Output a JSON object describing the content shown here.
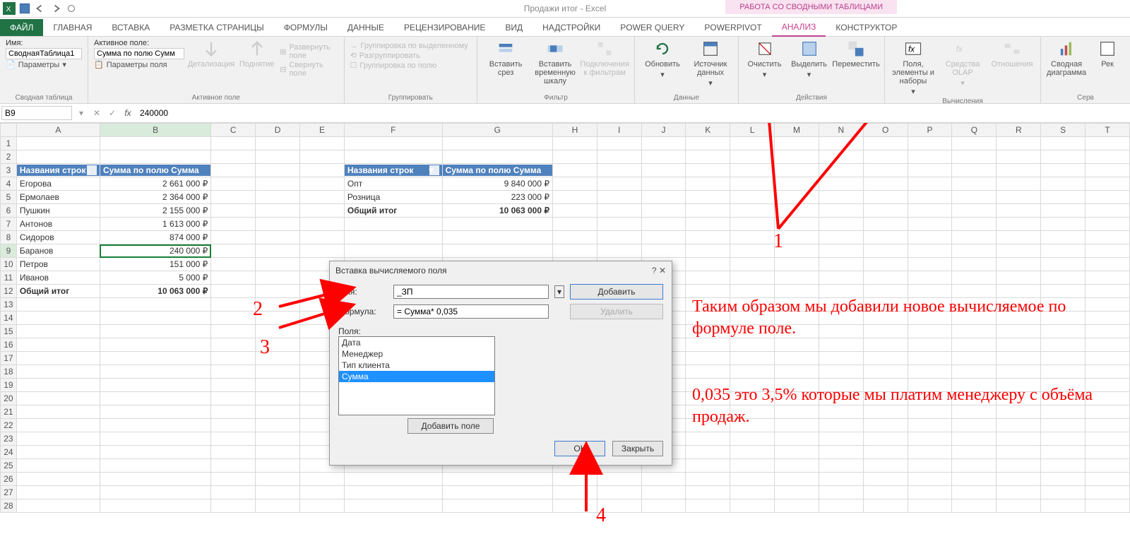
{
  "app_title": "Продажи итог - Excel",
  "contextual_tab": "РАБОТА СО СВОДНЫМИ ТАБЛИЦАМИ",
  "tabs": [
    "ФАЙЛ",
    "ГЛАВНАЯ",
    "ВСТАВКА",
    "РАЗМЕТКА СТРАНИЦЫ",
    "ФОРМУЛЫ",
    "ДАННЫЕ",
    "РЕЦЕНЗИРОВАНИЕ",
    "ВИД",
    "НАДСТРОЙКИ",
    "POWER QUERY",
    "POWERPIVOT",
    "АНАЛИЗ",
    "КОНСТРУКТОР"
  ],
  "ribbon": {
    "g1": {
      "label": "Сводная таблица",
      "name_lbl": "Имя:",
      "name_val": "СводнаяТаблица1",
      "params": "Параметры"
    },
    "g2": {
      "label": "Активное поле",
      "af_lbl": "Активное поле:",
      "af_val": "Сумма по полю Сумм",
      "fs": "Параметры поля",
      "drill_down": "Детализация",
      "drill_up": "Поднятие",
      "expand": "Развернуть поле",
      "collapse": "Свернуть поле"
    },
    "g3": {
      "label": "Группировать",
      "i1": "Группировка по выделенному",
      "i2": "Разгруппировать",
      "i3": "Группировка по полю"
    },
    "g4": {
      "label": "Фильтр",
      "slicer": "Вставить срез",
      "timeline": "Вставить временную шкалу",
      "conn": "Подключения к фильтрам"
    },
    "g5": {
      "label": "Данные",
      "refresh": "Обновить",
      "source": "Источник данных"
    },
    "g6": {
      "label": "Действия",
      "clear": "Очистить",
      "select": "Выделить",
      "move": "Переместить"
    },
    "g7": {
      "label": "Вычисления",
      "fields": "Поля, элементы и наборы",
      "olap": "Средства OLAP",
      "rel": "Отношения"
    },
    "g8": {
      "label": "Серв",
      "chart": "Сводная диаграмма",
      "rec": "Рек"
    }
  },
  "namebox": "B9",
  "formula_value": "240000",
  "columns": [
    "A",
    "B",
    "C",
    "D",
    "E",
    "F",
    "G",
    "H",
    "I",
    "J",
    "K",
    "L",
    "M",
    "N",
    "O",
    "P",
    "Q",
    "R",
    "S",
    "T"
  ],
  "pt1": {
    "h1": "Названия строк",
    "h2": "Сумма по полю Сумма",
    "rows": [
      [
        "Егорова",
        "2 661 000 ₽"
      ],
      [
        "Ермолаев",
        "2 364 000 ₽"
      ],
      [
        "Пушкин",
        "2 155 000 ₽"
      ],
      [
        "Антонов",
        "1 613 000 ₽"
      ],
      [
        "Сидоров",
        "874 000 ₽"
      ],
      [
        "Баранов",
        "240 000 ₽"
      ],
      [
        "Петров",
        "151 000 ₽"
      ],
      [
        "Иванов",
        "5 000 ₽"
      ]
    ],
    "total_lbl": "Общий итог",
    "total_val": "10 063 000 ₽"
  },
  "pt2": {
    "h1": "Названия строк",
    "h2": "Сумма по полю Сумма",
    "rows": [
      [
        "Опт",
        "9 840 000 ₽"
      ],
      [
        "Розница",
        "223 000 ₽"
      ]
    ],
    "total_lbl": "Общий итог",
    "total_val": "10 063 000 ₽"
  },
  "dialog": {
    "title": "Вставка вычисляемого поля",
    "name_lbl": "Имя:",
    "name_val": "_ЗП",
    "formula_lbl": "Формула:",
    "formula_val": "= Сумма* 0,035",
    "add": "Добавить",
    "delete": "Удалить",
    "fields_lbl": "Поля:",
    "fields": [
      "Дата",
      "Менеджер",
      "Тип клиента",
      "Сумма"
    ],
    "addfield": "Добавить поле",
    "ok": "OK",
    "close": "Закрыть"
  },
  "steps": {
    "s1": "1",
    "s2": "2",
    "s3": "3",
    "s4": "4"
  },
  "callout1": "Таким образом мы добавили новое вычисляемое по формуле поле.",
  "callout2": "0,035 это 3,5% которые мы платим менеджеру с объёма продаж."
}
